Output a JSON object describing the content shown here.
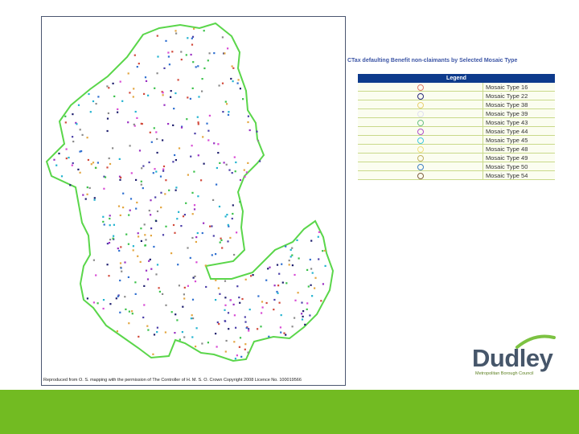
{
  "map": {
    "copyright": "Reproduced from O. S. mapping with the permission of The Controller of H. M. S. O. Crown Copyright 2008 Licence No. 100019566",
    "boundary_color": "#5ad64a",
    "point_colors": [
      "#d24a3c",
      "#4b3fa8",
      "#2f6fd0",
      "#d84ad4",
      "#9a2fc2",
      "#3ac14a",
      "#22b3d0",
      "#e3a640",
      "#8a8a8a",
      "#1f1f6e"
    ]
  },
  "legend": {
    "title": "CTax defaulting Benefit non-claimants by Selected Mosaic Type",
    "header": "Legend",
    "items": [
      {
        "label": "Mosaic Type 16",
        "color": "#e07a6a"
      },
      {
        "label": "Mosaic Type 22",
        "color": "#2a2a7a"
      },
      {
        "label": "Mosaic Type 38",
        "color": "#e8d070"
      },
      {
        "label": "Mosaic Type 39",
        "color": "#e0e0f0"
      },
      {
        "label": "Mosaic Type 43",
        "color": "#6ac080"
      },
      {
        "label": "Mosaic Type 44",
        "color": "#b050c8"
      },
      {
        "label": "Mosaic Type 45",
        "color": "#40c8e0"
      },
      {
        "label": "Mosaic Type 48",
        "color": "#f0e080"
      },
      {
        "label": "Mosaic Type 49",
        "color": "#c0b060"
      },
      {
        "label": "Mosaic Type 50",
        "color": "#4080c0"
      },
      {
        "label": "Mosaic Type 54",
        "color": "#806040"
      }
    ]
  },
  "logo": {
    "name": "Dudley",
    "subtitle": "Metropolitan Borough Council",
    "colors": {
      "text": "#46566a",
      "arc": "#7cc242"
    }
  },
  "footer": {
    "color": "#72bb22"
  }
}
